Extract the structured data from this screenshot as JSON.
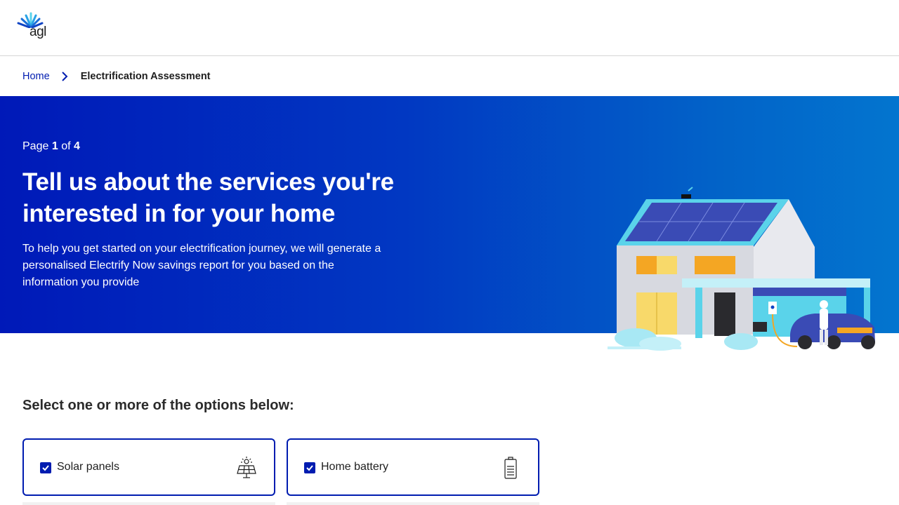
{
  "header": {
    "logo_text": "agl",
    "logo_icon": "agl-sunburst-logo-icon"
  },
  "breadcrumb": {
    "home_label": "Home",
    "separator_icon": "chevron-right-icon",
    "current_label": "Electrification Assessment"
  },
  "hero": {
    "page_prefix": "Page",
    "page_current": "1",
    "page_of": "of",
    "page_total": "4",
    "title": "Tell us about the services you're interested in for your home",
    "description": "To help you get started on your electrification journey, we will generate a personalised Electrify Now savings report for you based on the information you provide",
    "illustration": "house-with-solar-and-ev-illustration"
  },
  "options": {
    "heading": "Select one or more of the options below:",
    "items": [
      {
        "label": "Solar panels",
        "checked": true,
        "icon": "solar-panel-icon"
      },
      {
        "label": "Home battery",
        "checked": true,
        "icon": "battery-icon"
      }
    ]
  },
  "colors": {
    "brand_blue": "#001cb0",
    "hero_gradient_start": "#0019b8",
    "hero_gradient_end": "#0375cf",
    "accent_cyan": "#5ad3ea"
  }
}
